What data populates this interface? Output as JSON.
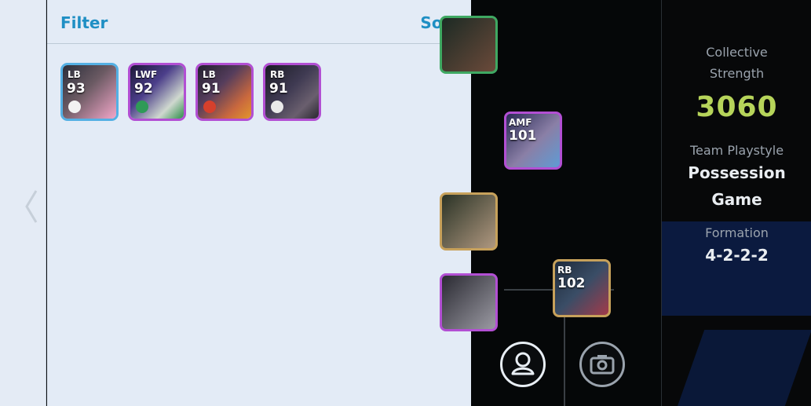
{
  "panel": {
    "filter_label": "Filter",
    "sort_label": "Sort"
  },
  "cards": [
    {
      "pos": "LB",
      "ovr": "93"
    },
    {
      "pos": "LWF",
      "ovr": "92"
    },
    {
      "pos": "LB",
      "ovr": "91"
    },
    {
      "pos": "RB",
      "ovr": "91"
    }
  ],
  "field_cards": [
    {
      "pos": "AMF",
      "ovr": "101"
    },
    {
      "pos": "RB",
      "ovr": "102"
    }
  ],
  "info": {
    "collective_label_1": "Collective",
    "collective_label_2": "Strength",
    "collective_value": "3060",
    "playstyle_label": "Team Playstyle",
    "playstyle_value_1": "Possession",
    "playstyle_value_2": "Game",
    "formation_label": "Formation",
    "formation_value": "4-2-2-2"
  },
  "colors": {
    "accent": "#1f8fc4",
    "strength": "#b6d45a",
    "card_border": "#b24fd3",
    "card_border_blue": "#54b0e4",
    "field_card_border": "#c7a15b"
  },
  "icons": [
    "chevron-left-icon",
    "user-icon",
    "camera-icon"
  ]
}
